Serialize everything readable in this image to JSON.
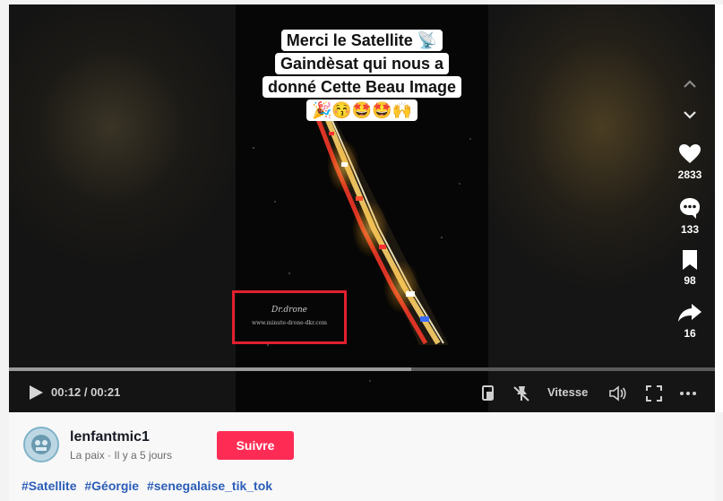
{
  "video": {
    "caption_lines": [
      "Merci le Satellite 📡",
      "Gaindèsat qui nous a",
      "donné Cette Beau Image",
      "🎉😚🤩🤩🙌"
    ],
    "watermark_title": "Dr.drone",
    "watermark_url": "www.minute-drone-dkr.com"
  },
  "actions": {
    "likes": "2833",
    "comments": "133",
    "saves": "98",
    "shares": "16"
  },
  "player": {
    "time": "00:12 / 00:21",
    "progress_fraction": 0.57,
    "speed_label": "Vitesse"
  },
  "author": {
    "username": "lenfantmic1",
    "subline": "La paix · Il y a 5 jours",
    "follow_label": "Suivre"
  },
  "hashtags": [
    "#Satellite",
    "#Géorgie",
    "#senegalaise_tik_tok"
  ],
  "colors": {
    "follow": "#fe2c55",
    "hashtag": "#2b5db8",
    "highlight_box": "#e0202e"
  }
}
